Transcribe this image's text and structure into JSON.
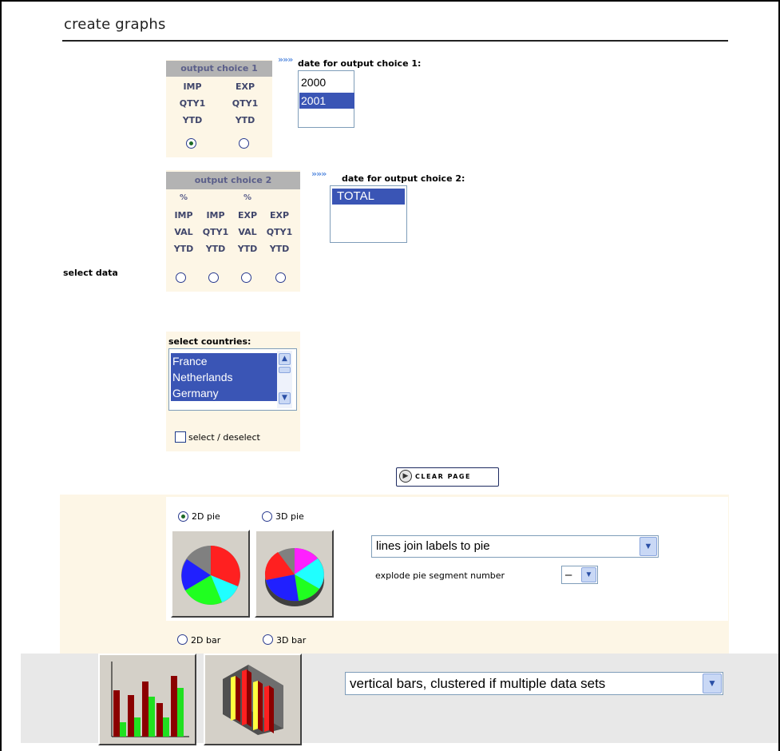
{
  "page": {
    "title": "create graphs"
  },
  "output_choice_1": {
    "header": "output choice 1",
    "columns": [
      {
        "lines": [
          "IMP",
          "QTY1",
          "YTD"
        ],
        "selected": true
      },
      {
        "lines": [
          "EXP",
          "QTY1",
          "YTD"
        ],
        "selected": false
      }
    ],
    "date_arrows": "»»»",
    "date_label": "date for output choice 1:",
    "dates": [
      {
        "text": "2000",
        "selected": false
      },
      {
        "text": "2001",
        "selected": true
      }
    ]
  },
  "output_choice_2": {
    "header": "output choice 2",
    "columns": [
      {
        "lines": [
          "%",
          "IMP",
          "VAL",
          "YTD"
        ],
        "selected": false
      },
      {
        "lines": [
          "",
          "IMP",
          "QTY1",
          "YTD"
        ],
        "selected": false
      },
      {
        "lines": [
          "%",
          "EXP",
          "VAL",
          "YTD"
        ],
        "selected": false
      },
      {
        "lines": [
          "",
          "EXP",
          "QTY1",
          "YTD"
        ],
        "selected": false
      }
    ],
    "date_arrows": "»»»",
    "date_label": "date for output choice 2:",
    "dates": [
      {
        "text": "TOTAL",
        "selected": true
      }
    ]
  },
  "select_data_label": "select data",
  "countries": {
    "label": "select countries:",
    "items": [
      {
        "text": "France",
        "selected": true
      },
      {
        "text": "Netherlands",
        "selected": true
      },
      {
        "text": "Germany",
        "selected": true
      }
    ],
    "select_deselect_label": "select / deselect",
    "select_deselect_checked": false
  },
  "clear_button": {
    "label": "CLEAR PAGE",
    "icon": "play-icon"
  },
  "pie": {
    "options": [
      {
        "label": "2D pie",
        "selected": true
      },
      {
        "label": "3D pie",
        "selected": false
      }
    ],
    "style_select": "lines join labels to pie",
    "explode_label": "explode pie segment number",
    "explode_value": "–"
  },
  "bar": {
    "options": [
      {
        "label": "2D bar",
        "selected": false
      },
      {
        "label": "3D bar",
        "selected": false
      }
    ],
    "style_select": "vertical bars, clustered if multiple data sets"
  },
  "colors": {
    "header_grey": "#b3b3b3",
    "panel_cream": "#fdf6e6",
    "list_selection": "#3a55b5",
    "bottom_band": "#e8e8e8"
  }
}
